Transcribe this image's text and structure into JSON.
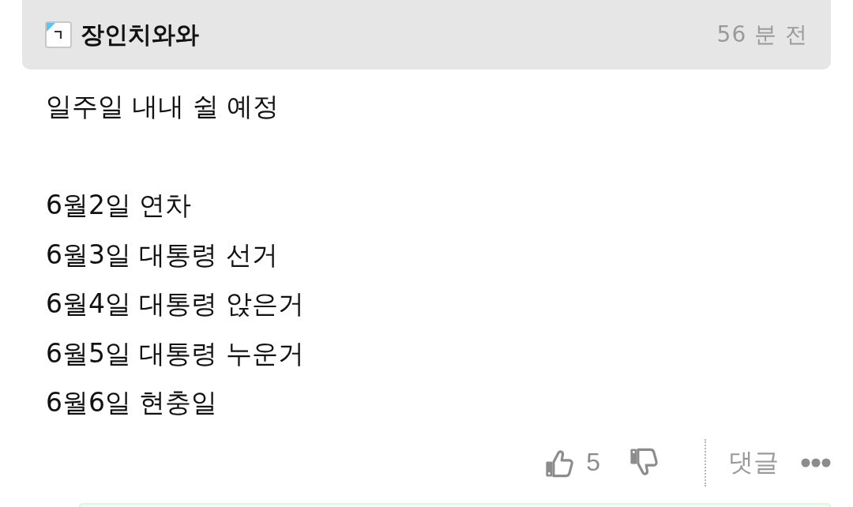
{
  "post": {
    "author": {
      "nickname": "장인치와와"
    },
    "time": "56 분 전",
    "paragraphs": [
      {
        "lines": [
          "일주일 내내 쉴 예정"
        ]
      },
      {
        "lines": [
          "6월2일 연차",
          "6월3일 대통령 선거",
          "6월4일 대통령 앉은거",
          "6월5일 대통령 누운거",
          "6월6일 현충일"
        ]
      }
    ],
    "actions": {
      "likes": "5",
      "reply_label": "댓글"
    }
  }
}
